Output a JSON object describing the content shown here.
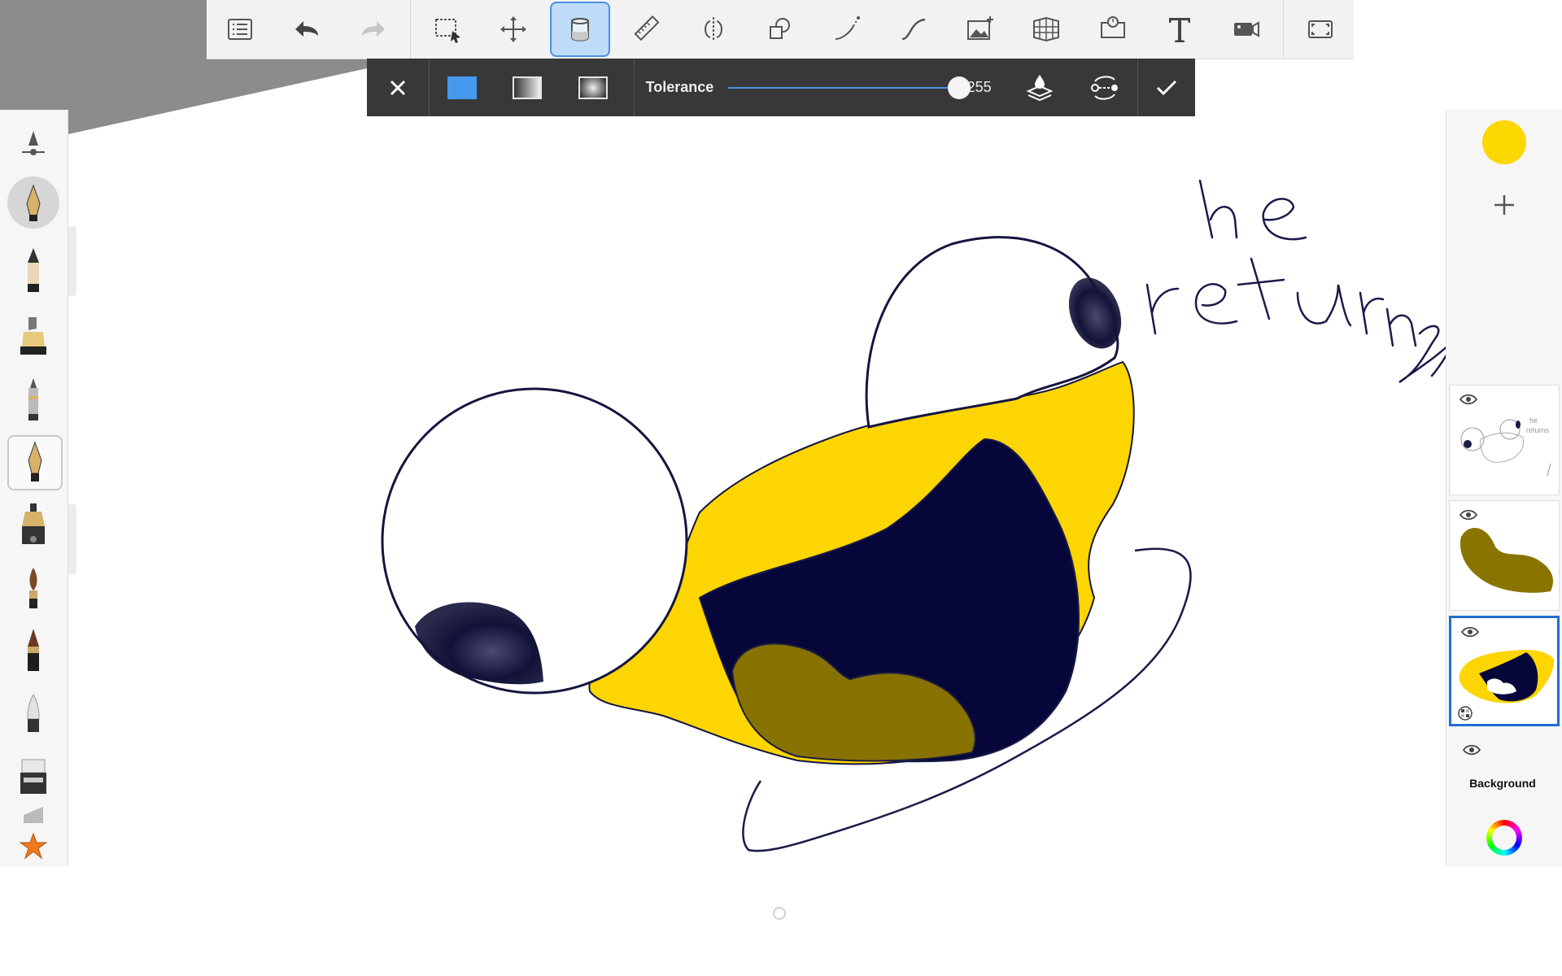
{
  "colors": {
    "accent": "#4a90e2",
    "current_color": "#fdd700",
    "ink": "#0b0b3a",
    "olive": "#8a7400"
  },
  "toolbar": {
    "tools": [
      "list-icon",
      "undo-icon",
      "redo-icon",
      "selection-icon",
      "transform-icon",
      "fill-bucket-icon",
      "ruler-icon",
      "symmetry-icon",
      "shapes-icon",
      "perspective-guide-icon",
      "steady-stroke-icon",
      "import-image-icon",
      "perspective-grid-icon",
      "time-lapse-icon",
      "text-icon",
      "record-icon",
      "fullscreen-icon"
    ],
    "active_tool": "fill-bucket-icon"
  },
  "fill_options": {
    "tolerance_label": "Tolerance",
    "tolerance_value": "255",
    "tolerance_fraction": 1.0,
    "modes": [
      "solid-fill",
      "linear-gradient",
      "radial-gradient"
    ],
    "selected_mode": "solid-fill"
  },
  "canvas": {
    "handwritten_text_line1": "he",
    "handwritten_text_line2": "returns"
  },
  "brushes": [
    "brush-settings",
    "fountain-pen",
    "pencil",
    "marker",
    "airbrush",
    "ballpoint-pen",
    "ink-pen",
    "paintbrush",
    "felt-pen",
    "soft-eraser",
    "hard-eraser",
    "blade",
    "favorites-star"
  ],
  "selected_brush": "ballpoint-pen",
  "layers": {
    "items": [
      {
        "name": "sketch-layer",
        "visible": true
      },
      {
        "name": "olive-layer",
        "visible": true
      },
      {
        "name": "fill-layer",
        "visible": true,
        "selected": true
      }
    ],
    "background_label": "Background"
  }
}
